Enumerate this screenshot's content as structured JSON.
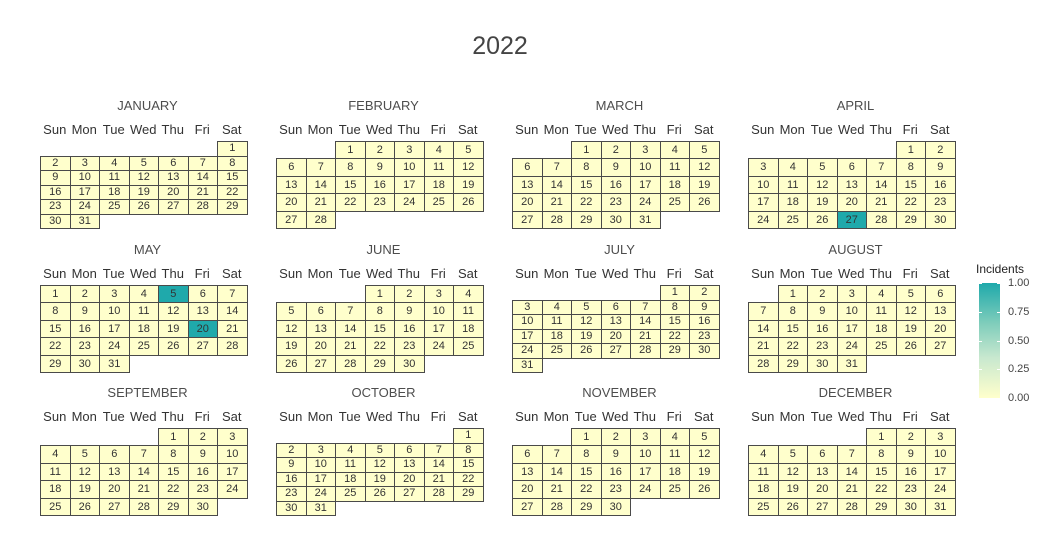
{
  "chart_data": {
    "type": "heatmap",
    "title": "2022",
    "year": 2022,
    "weekdays": [
      "Sun",
      "Mon",
      "Tue",
      "Wed",
      "Thu",
      "Fri",
      "Sat"
    ],
    "months": [
      "JANUARY",
      "FEBRUARY",
      "MARCH",
      "APRIL",
      "MAY",
      "JUNE",
      "JULY",
      "AUGUST",
      "SEPTEMBER",
      "OCTOBER",
      "NOVEMBER",
      "DECEMBER"
    ],
    "incidents": [
      {
        "date": "2022-04-27",
        "value": 1
      },
      {
        "date": "2022-05-05",
        "value": 1
      },
      {
        "date": "2022-05-20",
        "value": 1
      }
    ],
    "default_value": 0,
    "legend": {
      "title": "Incidents",
      "ticks": [
        "1.00",
        "0.75",
        "0.50",
        "0.25",
        "0.00"
      ],
      "range": [
        0,
        1
      ],
      "position": "right"
    },
    "colors": {
      "low": "#ffffcc",
      "high": "#1fa9ab",
      "cell_border": "#4a4a4a"
    }
  }
}
